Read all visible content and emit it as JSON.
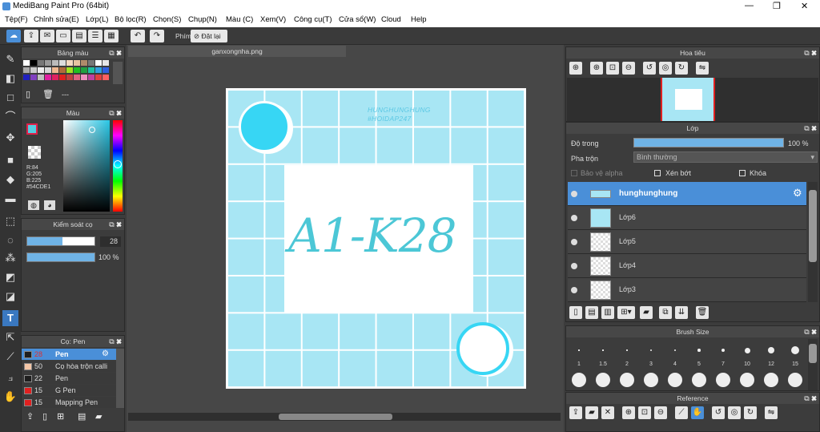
{
  "window": {
    "title": "MediBang Paint Pro (64bit)",
    "min": "—",
    "max": "❐",
    "close": "✕"
  },
  "menu": [
    "Tệp(F)",
    "Chỉnh sửa(E)",
    "Lớp(L)",
    "Bộ lọc(R)",
    "Chọn(S)",
    "Chụp(N)",
    "Màu (C)",
    "Xem(V)",
    "Công cụ(T)",
    "Cửa sổ(W)",
    "Cloud",
    "Help"
  ],
  "toolbar": {
    "phim_label": "Phím",
    "reset_label": "Đặt lại"
  },
  "palette": {
    "title": "Bảng màu",
    "footer": "---"
  },
  "color": {
    "title": "Màu",
    "r": "R:84",
    "g": "G:205",
    "b": "B:225",
    "hex": "#54CDE1",
    "main": "#54CDE1"
  },
  "brush_control": {
    "title": "Kiểm soát cọ",
    "size": "28",
    "opacity": "100 %"
  },
  "brush_list": {
    "title": "Cọ: Pen",
    "items": [
      {
        "size": "28",
        "name": "Pen",
        "color": "#1e1e1e"
      },
      {
        "size": "50",
        "name": "Cọ hòa trộn calli",
        "color": "#f4c7a8"
      },
      {
        "size": "22",
        "name": "Pen",
        "color": "#1e1e1e"
      },
      {
        "size": "15",
        "name": "G Pen",
        "color": "#e02020"
      },
      {
        "size": "15",
        "name": "Mapping Pen",
        "color": "#e02020"
      }
    ]
  },
  "canvas": {
    "tab": "ganxongnha.png",
    "watermark1": "HUNGHUNGHUNG",
    "watermark2": "#HOIDAP247",
    "text": "A1-K28"
  },
  "navigator": {
    "title": "Hoa tiêu"
  },
  "layer": {
    "title": "Lớp",
    "opacity_label": "Độ trong",
    "opacity_value": "100 %",
    "opacity_fraction": 1.0,
    "blend_label": "Pha trộn",
    "blend_value": "Bình thường",
    "protect_alpha": "Bảo vệ alpha",
    "clipping": "Xén bớt",
    "lock": "Khóa",
    "layers": [
      "hunghunghung",
      "Lớp6",
      "Lớp5",
      "Lớp4",
      "Lớp3"
    ]
  },
  "brush_size": {
    "title": "Brush Size",
    "labels": [
      "1",
      "1.5",
      "2",
      "3",
      "4",
      "5",
      "7",
      "10",
      "12",
      "15"
    ]
  },
  "reference": {
    "title": "Reference"
  }
}
